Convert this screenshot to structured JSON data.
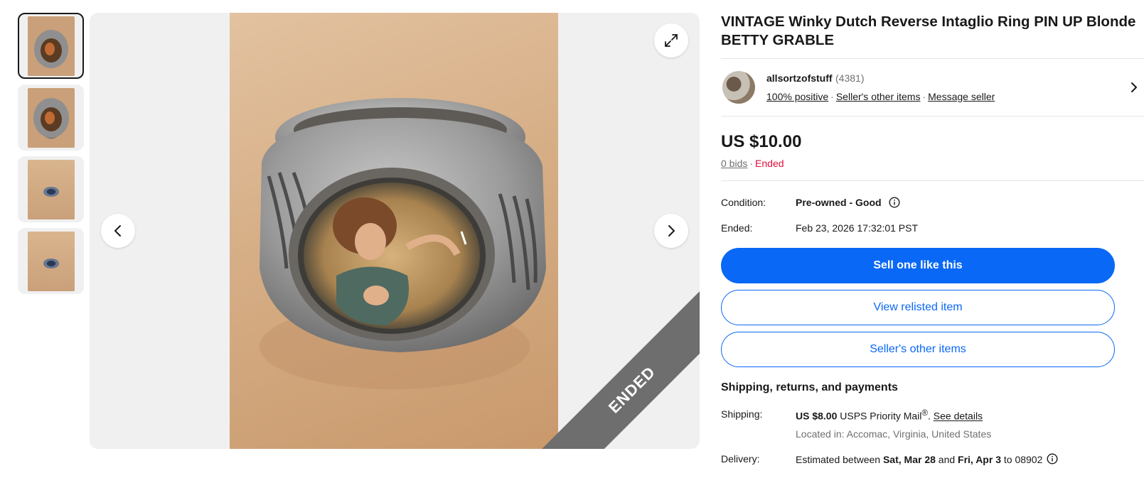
{
  "gallery": {
    "thumbnails": [
      {
        "name": "thumb-1",
        "selected": true,
        "image": "ring-front"
      },
      {
        "name": "thumb-2",
        "selected": false,
        "image": "ring-front"
      },
      {
        "name": "thumb-3",
        "selected": false,
        "image": "ring-side"
      },
      {
        "name": "thumb-4",
        "selected": false,
        "image": "ring-side"
      }
    ],
    "ribbon_text": "ENDED",
    "icons": {
      "expand": "expand-icon",
      "prev": "chevron-left-icon",
      "next": "chevron-right-icon"
    }
  },
  "listing": {
    "title": "VINTAGE Winky Dutch Reverse Intaglio Ring PIN UP Blonde BETTY GRABLE"
  },
  "seller": {
    "name": "allsortzofstuff",
    "score": "(4381)",
    "positive": "100% positive",
    "other_items_link": "Seller's other items",
    "message_link": "Message seller"
  },
  "price": {
    "amount": "US $10.00",
    "bids": "0 bids",
    "status": "Ended"
  },
  "details": {
    "condition_label": "Condition:",
    "condition_value": "Pre-owned - Good",
    "ended_label": "Ended:",
    "ended_value": "Feb 23, 2026 17:32:01 PST"
  },
  "buttons": {
    "sell_one": "Sell one like this",
    "view_relisted": "View relisted item",
    "sellers_other": "Seller's other items"
  },
  "shipping": {
    "heading": "Shipping, returns, and payments",
    "shipping_label": "Shipping:",
    "shipping_cost": "US $8.00",
    "shipping_service": "USPS Priority Mail",
    "registered": "®",
    "see_details": "See details",
    "location": "Located in: Accomac, Virginia, United States",
    "delivery_label": "Delivery:",
    "delivery_prefix": "Estimated between",
    "delivery_start": "Sat, Mar 28",
    "delivery_and": "and",
    "delivery_end": "Fri, Apr 3",
    "delivery_to": "to 08902"
  },
  "colors": {
    "accent": "#0968f6",
    "ended": "#e0103a",
    "muted": "#707070"
  }
}
